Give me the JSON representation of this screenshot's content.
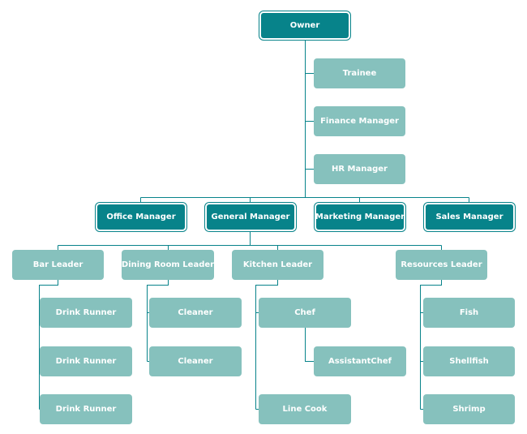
{
  "colors": {
    "primary": "#07838a",
    "secondary": "#86c1bd",
    "connector": "#07838a",
    "text": "#ffffff"
  },
  "owner": "Owner",
  "assistants": [
    "Trainee",
    "Finance Manager",
    "HR Manager"
  ],
  "managers": [
    "Office Manager",
    "General Manager",
    "Marketing Manager",
    "Sales Manager"
  ],
  "leaders": [
    "Bar Leader",
    "Dining Room Leader",
    "Kitchen Leader",
    "Resources Leader"
  ],
  "bar_staff": [
    "Drink Runner",
    "Drink Runner",
    "Drink Runner"
  ],
  "dining_staff": [
    "Cleaner",
    "Cleaner"
  ],
  "kitchen_staff": {
    "chef": "Chef",
    "assistant_chef": "AssistantChef",
    "line_cook": "Line Cook"
  },
  "resources_staff": [
    "Fish",
    "Shellfish",
    "Shrimp"
  ]
}
